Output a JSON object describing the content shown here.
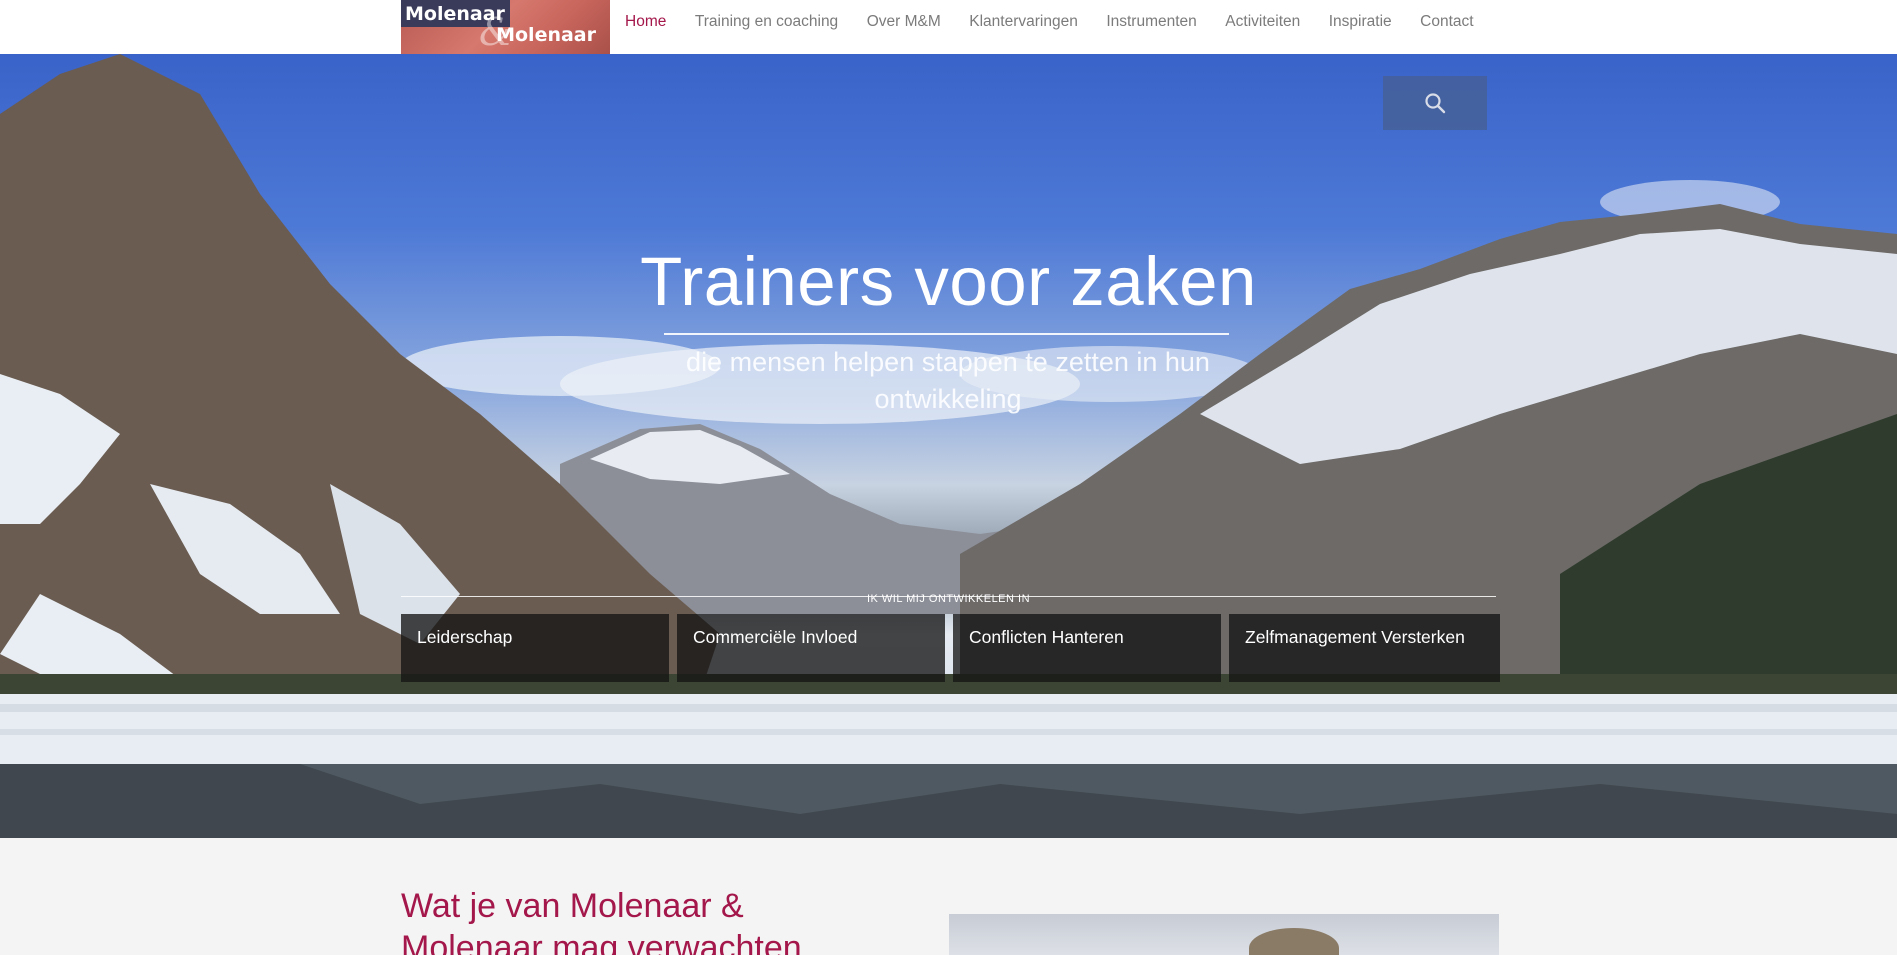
{
  "logo": {
    "line1": "Molenaar",
    "ampersand": "&",
    "line2": "Molenaar"
  },
  "nav": {
    "items": [
      {
        "label": "Home",
        "active": true
      },
      {
        "label": "Training en coaching"
      },
      {
        "label": "Over M&M"
      },
      {
        "label": "Klantervaringen"
      },
      {
        "label": "Instrumenten"
      },
      {
        "label": "Activiteiten"
      },
      {
        "label": "Inspiratie"
      },
      {
        "label": "Contact"
      }
    ],
    "active_color": "#a3174a"
  },
  "search": {
    "icon": "search-icon"
  },
  "hero": {
    "title": "Trainers voor zaken",
    "subtitle": "die mensen helpen stappen te zetten in hun ontwikkeling",
    "develop_label": "IK WIL MIJ ONTWIKKELEN IN",
    "tiles": [
      "Leiderschap",
      "Commerciële Invloed",
      "Conflicten Hanteren",
      "Zelfmanagement Versterken"
    ]
  },
  "content": {
    "heading": "Wat je van Molenaar & Molenaar mag verwachten"
  }
}
